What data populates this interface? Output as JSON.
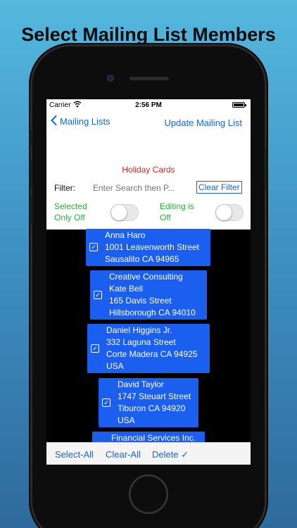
{
  "headline": "Select Mailing List Members",
  "status_bar": {
    "carrier": "Carrier",
    "wifi_icon": "wifi-icon",
    "time": "2:56 PM",
    "battery_icon": "battery-icon"
  },
  "nav": {
    "back_label": "Mailing Lists",
    "back_icon": "chevron-left-icon",
    "right_label": "Update Mailing List"
  },
  "list_name": "Holiday Cards",
  "filter": {
    "label": "Filter:",
    "placeholder": "Enter Search then P...",
    "value": "",
    "clear_label": "Clear Filter"
  },
  "toggles": {
    "selected_only": {
      "label_line1": "Selected",
      "label_line2": "Only Off",
      "on": false
    },
    "editing": {
      "label_line1": "Editing is",
      "label_line2": "Off",
      "on": false
    }
  },
  "colors": {
    "card_blue": "#1a5ff0",
    "accent_blue": "#1565e0",
    "list_name_red": "#e02020",
    "toggle_label_green": "#27b33a"
  },
  "contacts": [
    {
      "selected": true,
      "lines": [
        "Anna Haro",
        "1001  Leavenworth Street",
        "Sausalito CA 94965"
      ]
    },
    {
      "selected": true,
      "lines": [
        "Creative Consulting",
        "Kate Bell",
        "165 Davis Street",
        "Hillsborough CA 94010"
      ]
    },
    {
      "selected": true,
      "lines": [
        "Daniel Higgins Jr.",
        "332 Laguna Street",
        "Corte Madera CA 94925",
        "USA"
      ]
    },
    {
      "selected": true,
      "lines": [
        "David Taylor",
        "1747 Steuart Street",
        "Tiburon CA 94920",
        "USA"
      ]
    },
    {
      "selected": true,
      "lines": [
        "Financial Services Inc."
      ]
    }
  ],
  "toolbar": {
    "select_all": "Select-All",
    "clear_all": "Clear-All",
    "delete": "Delete ✓"
  }
}
